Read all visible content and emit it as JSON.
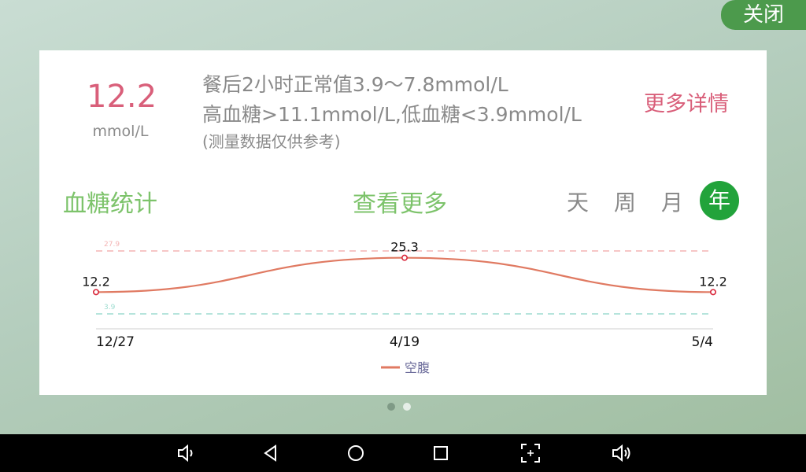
{
  "header": {
    "close_label": "关闭"
  },
  "reading": {
    "value": "12.2",
    "unit": "mmol/L"
  },
  "reference": {
    "line1": "餐后2小时正常值3.9～7.8mmol/L",
    "line2": "高血糖>11.1mmol/L,低血糖<3.9mmol/L",
    "note": "(测量数据仅供参考)"
  },
  "links": {
    "more_details": "更多详情",
    "view_more": "查看更多"
  },
  "stats": {
    "title": "血糖统计"
  },
  "periods": [
    {
      "label": "天",
      "active": false
    },
    {
      "label": "周",
      "active": false
    },
    {
      "label": "月",
      "active": false
    },
    {
      "label": "年",
      "active": true
    }
  ],
  "chart_data": {
    "type": "line",
    "categories": [
      "12/27",
      "4/19",
      "5/4"
    ],
    "series": [
      {
        "name": "空腹",
        "values": [
          12.2,
          25.3,
          12.2
        ],
        "color": "#e07a62"
      }
    ],
    "reference_lines": [
      {
        "label": "27.9",
        "value": 27.9,
        "color": "#f4b4b4"
      },
      {
        "label": "3.9",
        "value": 3.9,
        "color": "#9edcd0"
      }
    ],
    "ylim": [
      0,
      30
    ],
    "legend": "bottom-center"
  },
  "pager": {
    "count": 2,
    "active_index": 0
  },
  "colors": {
    "accent_pink": "#d95f7a",
    "accent_green": "#7dc36b",
    "active_period": "#22a33b"
  },
  "navigation": {
    "buttons": [
      {
        "name": "volume-down-button",
        "icon": "volume-down-icon"
      },
      {
        "name": "back-button",
        "icon": "back-triangle-icon"
      },
      {
        "name": "home-button",
        "icon": "home-circle-icon"
      },
      {
        "name": "recents-button",
        "icon": "recents-square-icon"
      },
      {
        "name": "screenshot-button",
        "icon": "screenshot-icon"
      },
      {
        "name": "volume-up-button",
        "icon": "volume-up-icon"
      }
    ]
  }
}
